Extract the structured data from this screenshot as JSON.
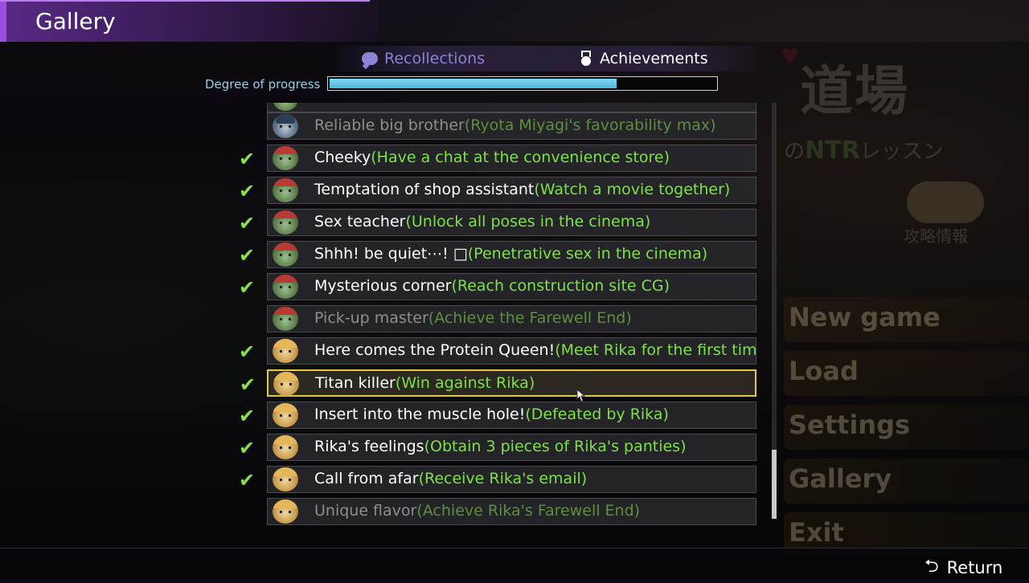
{
  "window": {
    "title": "Gallery"
  },
  "tabs": [
    {
      "label": "Recollections",
      "icon": "speech-bubble-icon",
      "active": false
    },
    {
      "label": "Achievements",
      "icon": "medal-icon",
      "active": true
    }
  ],
  "progress": {
    "label": "Degree of progress",
    "fraction": 0.74
  },
  "achievements": [
    {
      "name": "Reliable big brother",
      "condition": "(Ryota Miyagi's favorability max)",
      "unlocked": false,
      "avatar": "blue-hair"
    },
    {
      "name": "Cheeky",
      "condition": "(Have a chat at the convenience store)",
      "unlocked": true,
      "avatar": "green-cap"
    },
    {
      "name": "Temptation of shop assistant",
      "condition": "(Watch a movie together)",
      "unlocked": true,
      "avatar": "green-cap"
    },
    {
      "name": "Sex teacher",
      "condition": "(Unlock all poses in the cinema)",
      "unlocked": true,
      "avatar": "green-cap"
    },
    {
      "name": "Shhh! be quiet⋯! □",
      "condition": "(Penetrative sex in the cinema)",
      "unlocked": true,
      "avatar": "green-cap"
    },
    {
      "name": "Mysterious corner",
      "condition": "(Reach construction site CG)",
      "unlocked": true,
      "avatar": "green-cap"
    },
    {
      "name": "Pick-up master",
      "condition": "(Achieve the Farewell End)",
      "unlocked": false,
      "avatar": "green-cap"
    },
    {
      "name": "Here comes the Protein Queen!",
      "condition": "(Meet Rika for the first tim",
      "unlocked": true,
      "avatar": "blonde"
    },
    {
      "name": "Titan killer",
      "condition": "(Win against Rika)",
      "unlocked": true,
      "avatar": "blonde",
      "selected": true
    },
    {
      "name": "Insert into the muscle hole!",
      "condition": "(Defeated by Rika)",
      "unlocked": true,
      "avatar": "blonde"
    },
    {
      "name": "Rika's feelings",
      "condition": "(Obtain 3 pieces of Rika's panties)",
      "unlocked": true,
      "avatar": "blonde"
    },
    {
      "name": "Call from afar",
      "condition": "(Receive Rika's email)",
      "unlocked": true,
      "avatar": "blonde"
    },
    {
      "name": "Unique flavor",
      "condition": "(Achieve Rika's Farewell End)",
      "unlocked": false,
      "avatar": "blonde"
    }
  ],
  "background_menu": [
    "New game",
    "Load",
    "Settings",
    "Gallery",
    "Exit"
  ],
  "background_logo": {
    "main": "道場",
    "sub_prefix": "の",
    "sub_ntr": "NTR",
    "sub_suffix": "レッスン",
    "strategy": "攻略情報"
  },
  "footer": {
    "return_label": "Return",
    "return_icon": "return-arrow-icon"
  },
  "colors": {
    "accent_purple": "#5a2a86",
    "condition_green": "#7ee04a",
    "check_green": "#8ae04a",
    "selection_gold": "#e6c548",
    "progress_blue": "#6ccbea"
  }
}
